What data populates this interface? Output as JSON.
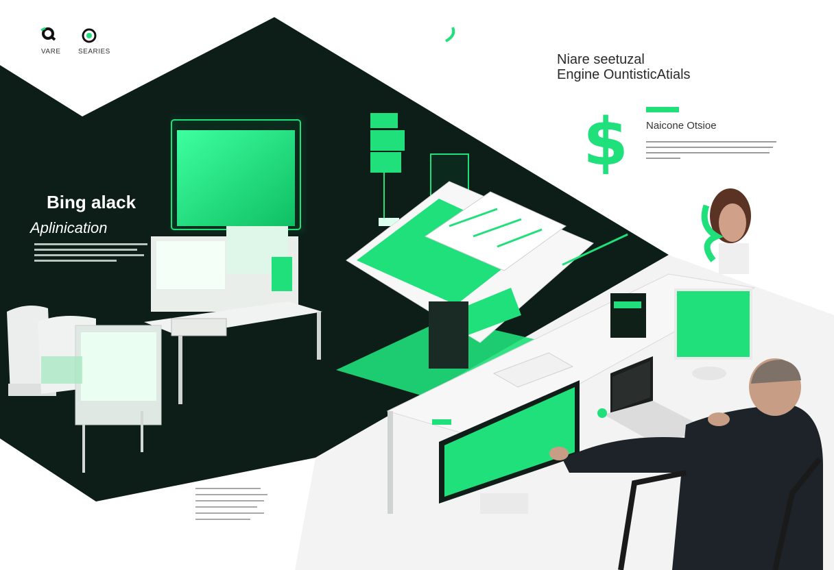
{
  "nav": {
    "left_label": "VARE",
    "right_label": "SEARIES"
  },
  "hero": {
    "title": "Bing alack",
    "subtitle": "Aplinication"
  },
  "top_right": {
    "line1": "Niare seetuzal",
    "line2": "Engine OuntisticAtials"
  },
  "feature": {
    "title": "Naicone Otsioe"
  },
  "colors": {
    "accent": "#1fe07a",
    "dark": "#0e1f1a",
    "bg": "#ffffff"
  },
  "icons": {
    "logo": "q-logo-icon",
    "eye": "eye-icon",
    "dollar": "dollar-icon"
  }
}
